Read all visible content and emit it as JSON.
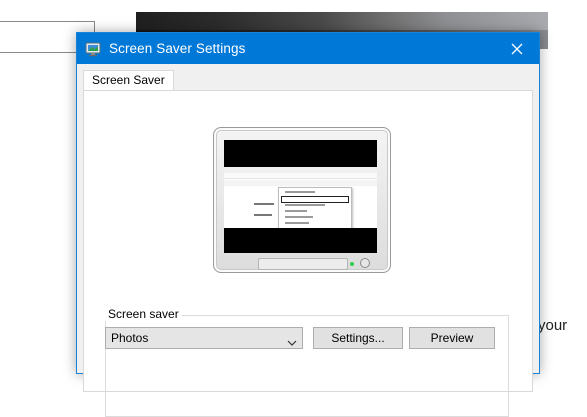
{
  "background": {
    "partial_text": "your"
  },
  "window": {
    "title": "Screen Saver Settings",
    "tabs": [
      {
        "label": "Screen Saver"
      }
    ]
  },
  "screen_saver_group": {
    "label": "Screen saver",
    "selected": "Photos",
    "settings_label": "Settings...",
    "preview_label": "Preview"
  },
  "colors": {
    "titlebar": "#0078d7",
    "window_border": "#1883d7",
    "panel_bg": "#ffffff",
    "chrome_bg": "#f0f0f0"
  },
  "icons": {
    "title": "display-properties-icon",
    "close": "close-icon",
    "dropdown": "chevron-down-icon"
  }
}
